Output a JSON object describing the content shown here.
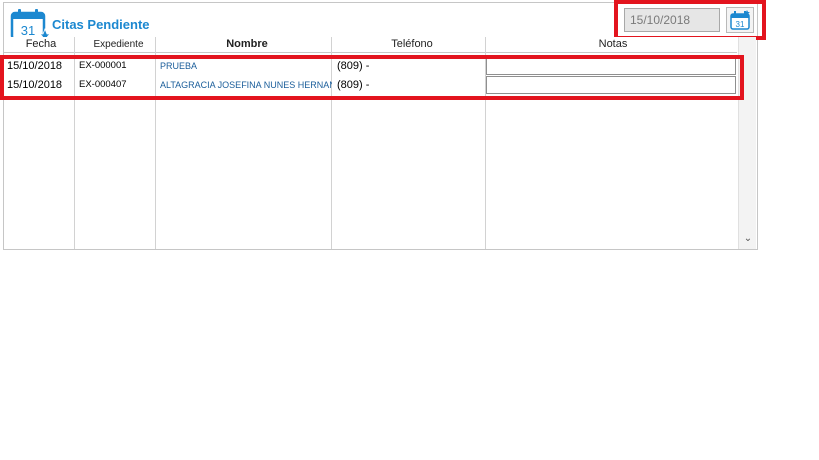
{
  "header": {
    "icon_day": "31",
    "title": "Citas Pendiente",
    "date_value": "15/10/2018",
    "calendar_button_day": "31"
  },
  "columns": {
    "fecha": "Fecha",
    "expediente": "Expediente",
    "nombre": "Nombre",
    "telefono": "Teléfono",
    "notas": "Notas"
  },
  "rows": [
    {
      "fecha": "15/10/2018",
      "expediente": "EX-000001",
      "nombre": "PRUEBA",
      "telefono": "(809)   -",
      "notas": ""
    },
    {
      "fecha": "15/10/2018",
      "expediente": "EX-000407",
      "nombre": "ALTAGRACIA JOSEFINA NUNES HERNANDEZ",
      "telefono": "(809)   -",
      "notas": ""
    }
  ],
  "colors": {
    "accent": "#1c88d0",
    "highlight": "#e3141e"
  },
  "icons": {
    "header": "calendar-icon",
    "date_button": "calendar-icon",
    "scroll": "chevron-down-icon"
  }
}
